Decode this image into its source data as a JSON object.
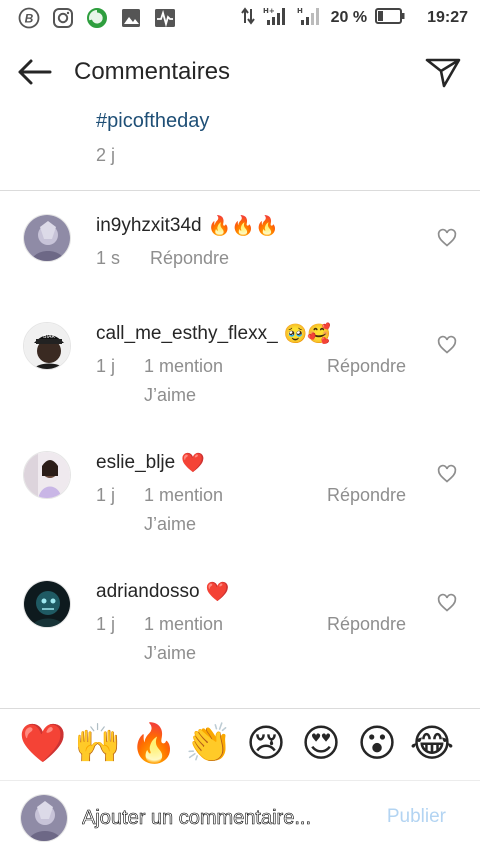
{
  "status_bar": {
    "icons": [
      "b-circle-icon",
      "instagram-icon",
      "data-saver-icon",
      "gallery-icon",
      "activity-icon"
    ],
    "network_icons": [
      "data-arrows-icon",
      "signal-h-plus-icon",
      "signal-h-icon"
    ],
    "battery": "20 %",
    "time": "19:27"
  },
  "header": {
    "title": "Commentaires"
  },
  "caption": {
    "hashtag": "#picoftheday",
    "time": "2 j"
  },
  "comments": [
    {
      "username": "in9yhzxit34d",
      "emoji": "🔥🔥🔥",
      "time": "1 s",
      "reply": "Répondre"
    },
    {
      "username": "call_me_esthy_flexx_",
      "emoji": "🥹🥰",
      "time": "1 j",
      "mention": "1 mention",
      "reply": "Répondre",
      "like": "J’aime"
    },
    {
      "username": "eslie_blje",
      "emoji": "❤️",
      "time": "1 j",
      "mention": "1 mention",
      "reply": "Répondre",
      "like": "J’aime"
    },
    {
      "username": "adriandosso",
      "emoji": "❤️",
      "time": "1 j",
      "mention": "1 mention",
      "reply": "Répondre",
      "like": "J’aime"
    }
  ],
  "emoji_bar": [
    "❤️",
    "🙌",
    "🔥",
    "👏",
    "😢",
    "😍",
    "😮",
    "😂"
  ],
  "composer": {
    "placeholder": "Ajouter un commentaire...",
    "publish": "Publier"
  },
  "colors": {
    "hashtag": "#1f4f76",
    "secondary_text": "#8e8e8e",
    "publish_disabled": "#b3d4f2",
    "divider": "#dbdbdb"
  }
}
